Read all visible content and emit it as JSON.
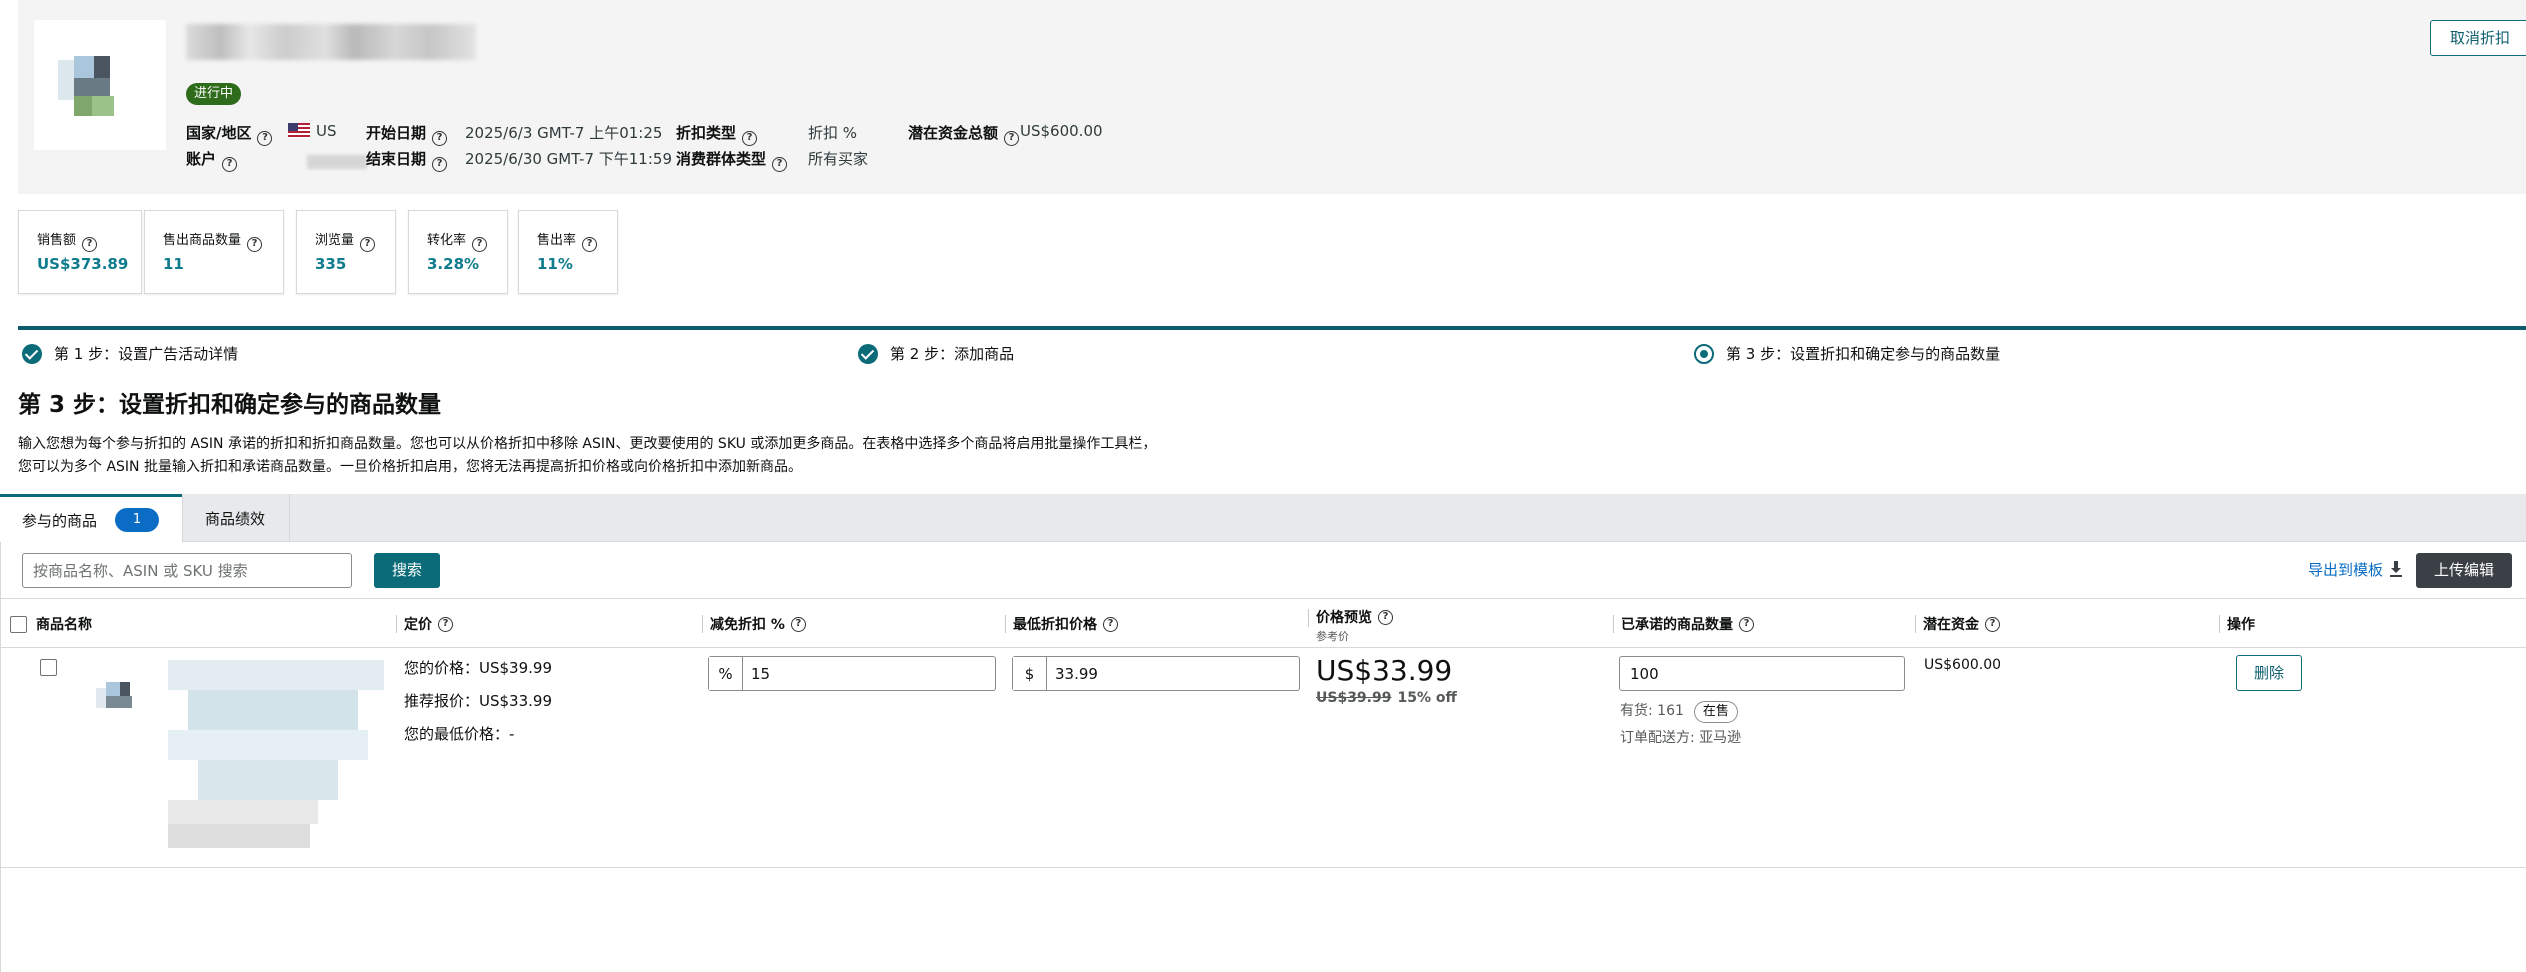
{
  "header": {
    "status": "进行中",
    "cancel_label": "取消折扣",
    "country_label": "国家/地区",
    "country_value": "US",
    "start_label": "开始日期",
    "start_value": "2025/6/3 GMT-7 上午01:25",
    "discount_type_label": "折扣类型",
    "discount_type_value": "折扣 %",
    "funding_label": "潜在资金总额",
    "funding_value": "US$600.00",
    "account_label": "账户",
    "end_label": "结束日期",
    "end_value": "2025/6/30 GMT-7 下午11:59",
    "audience_label": "消费群体类型",
    "audience_value": "所有买家"
  },
  "metrics": [
    {
      "label": "销售额",
      "value": "US$373.89"
    },
    {
      "label": "售出商品数量",
      "value": "11"
    },
    {
      "label": "浏览量",
      "value": "335"
    },
    {
      "label": "转化率",
      "value": "3.28%"
    },
    {
      "label": "售出率",
      "value": "11%"
    }
  ],
  "steps": [
    {
      "label": "第 1 步：设置广告活动详情",
      "state": "done"
    },
    {
      "label": "第 2 步：添加商品",
      "state": "done"
    },
    {
      "label": "第 3 步：设置折扣和确定参与的商品数量",
      "state": "current"
    }
  ],
  "section": {
    "title": "第 3 步：设置折扣和确定参与的商品数量",
    "desc_line1": "输入您想为每个参与折扣的 ASIN 承诺的折扣和折扣商品数量。您也可以从价格折扣中移除 ASIN、更改要使用的 SKU 或添加更多商品。在表格中选择多个商品将启用批量操作工具栏，",
    "desc_line2": "您可以为多个 ASIN 批量输入折扣和承诺商品数量。一旦价格折扣启用，您将无法再提高折扣价格或向价格折扣中添加新商品。"
  },
  "tabs": [
    {
      "label": "参与的商品",
      "count": "1",
      "active": true
    },
    {
      "label": "商品绩效",
      "active": false
    }
  ],
  "search": {
    "placeholder": "按商品名称、ASIN 或 SKU 搜索",
    "button": "搜索",
    "export": "导出到模板",
    "upload": "上传编辑"
  },
  "table": {
    "headers": {
      "name": "商品名称",
      "price": "定价",
      "discount": "减免折扣 %",
      "min_price": "最低折扣价格",
      "preview": "价格预览",
      "preview_sub": "参考价",
      "committed": "已承诺的商品数量",
      "funding": "潜在资金",
      "action": "操作"
    },
    "rows": [
      {
        "your_price": "您的价格：US$39.99",
        "list_price": "推荐报价：US$33.99",
        "min_price_text": "您的最低价格：-",
        "discount_prefix": "%",
        "discount_value": "15",
        "min_prefix": "$",
        "min_value": "33.99",
        "preview_price": "US$33.99",
        "preview_was": "US$39.99",
        "preview_off": "15% off",
        "committed_value": "100",
        "stock_text": "有货: 161",
        "stock_badge": "在售",
        "fulfillment": "订单配送方: 亚马逊",
        "funding": "US$600.00",
        "action": "删除"
      }
    ]
  },
  "colors": {
    "accent": "#0b6b78",
    "link": "#0a6cc4",
    "status_green": "#2e6b1b",
    "dark_button": "#3a4046"
  }
}
